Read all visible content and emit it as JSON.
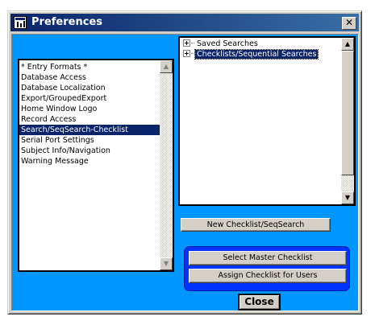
{
  "window": {
    "title": "Preferences",
    "close_glyph": "✕",
    "icon": "preferences-window-icon"
  },
  "categories": {
    "items": [
      "* Entry Formats *",
      "Database Access",
      "Database Localization",
      "Export/GroupedExport",
      "Home Window Logo",
      "Record Access",
      "Search/SeqSearch-Checklist",
      "Serial Port Settings",
      "Subject Info/Navigation",
      "Warning Message"
    ],
    "selected": "Search/SeqSearch-Checklist"
  },
  "tree": {
    "items": [
      {
        "label": "Saved Searches",
        "selected": false
      },
      {
        "label": "Checklists/Sequential Searches",
        "selected": true
      }
    ]
  },
  "buttons": {
    "new_checklist": "New Checklist/SeqSearch",
    "select_master": "Select Master Checklist",
    "assign_checklist": "Assign Checklist for Users",
    "close": "Close"
  },
  "scroll_glyphs": {
    "up": "▲",
    "down": "▼"
  },
  "colors": {
    "client_background": "#0096ff",
    "panel_background": "#0033ff",
    "selection": "#0a246a",
    "title_gradient_start": "#0a246a",
    "title_gradient_end": "#3a6ea5"
  }
}
